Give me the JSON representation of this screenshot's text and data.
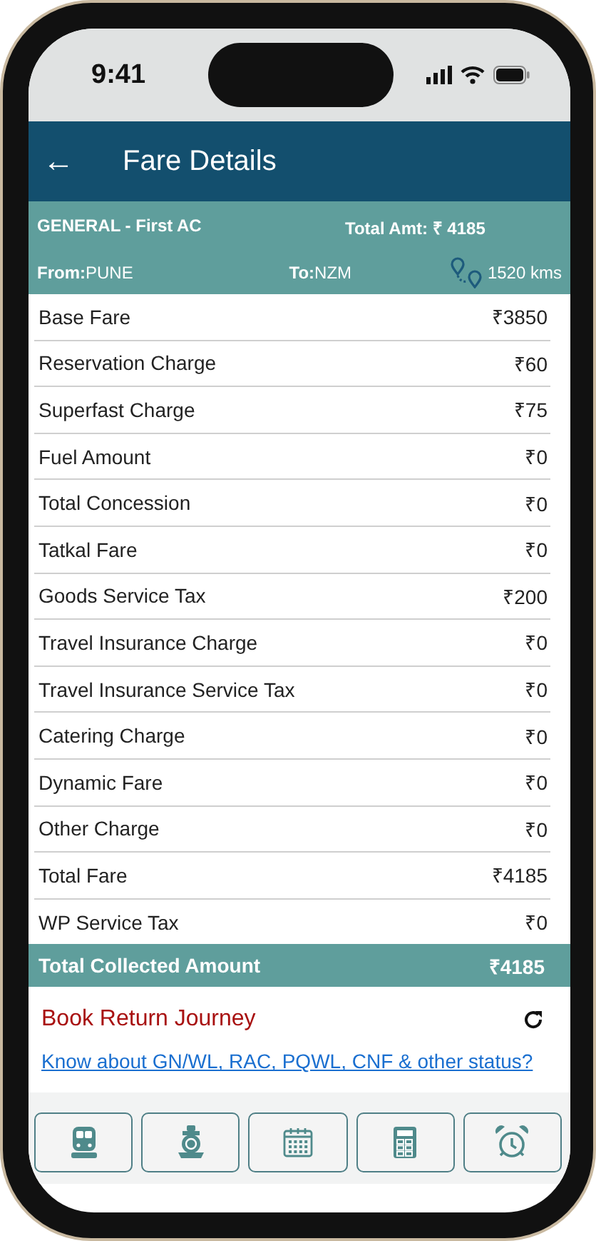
{
  "status_bar": {
    "time": "9:41"
  },
  "header": {
    "back_icon": "←",
    "title": "Fare Details"
  },
  "summary": {
    "class_label": "GENERAL - First AC",
    "total_label": "Total Amt:",
    "total_value": "₹ 4185",
    "from_label": "From:",
    "from_value": "PUNE",
    "to_label": "To:",
    "to_value": "NZM",
    "distance": "1520 kms"
  },
  "fare_rows": [
    {
      "label": "Base Fare",
      "value": "₹3850"
    },
    {
      "label": "Reservation Charge",
      "value": "₹60"
    },
    {
      "label": "Superfast Charge",
      "value": "₹75"
    },
    {
      "label": "Fuel Amount",
      "value": "₹0"
    },
    {
      "label": "Total Concession",
      "value": "₹0"
    },
    {
      "label": "Tatkal Fare",
      "value": "₹0"
    },
    {
      "label": "Goods Service Tax",
      "value": "₹200"
    },
    {
      "label": "Travel Insurance Charge",
      "value": "₹0"
    },
    {
      "label": "Travel Insurance Service Tax",
      "value": "₹0"
    },
    {
      "label": "Catering Charge",
      "value": "₹0"
    },
    {
      "label": "Dynamic Fare",
      "value": "₹0"
    },
    {
      "label": "Other Charge",
      "value": "₹0"
    },
    {
      "label": "Total Fare",
      "value": "₹4185"
    },
    {
      "label": "WP Service Tax",
      "value": "₹0"
    }
  ],
  "total_collected": {
    "label": "Total Collected Amount",
    "value": "₹4185"
  },
  "return_journey": {
    "label": "Book Return Journey"
  },
  "status_link": "Know about GN/WL, RAC, PQWL, CNF & other status?",
  "bottom_bar": [
    {
      "kind": "train"
    },
    {
      "kind": "engine"
    },
    {
      "kind": "calendar"
    },
    {
      "kind": "calculator"
    },
    {
      "kind": "alarm"
    }
  ]
}
